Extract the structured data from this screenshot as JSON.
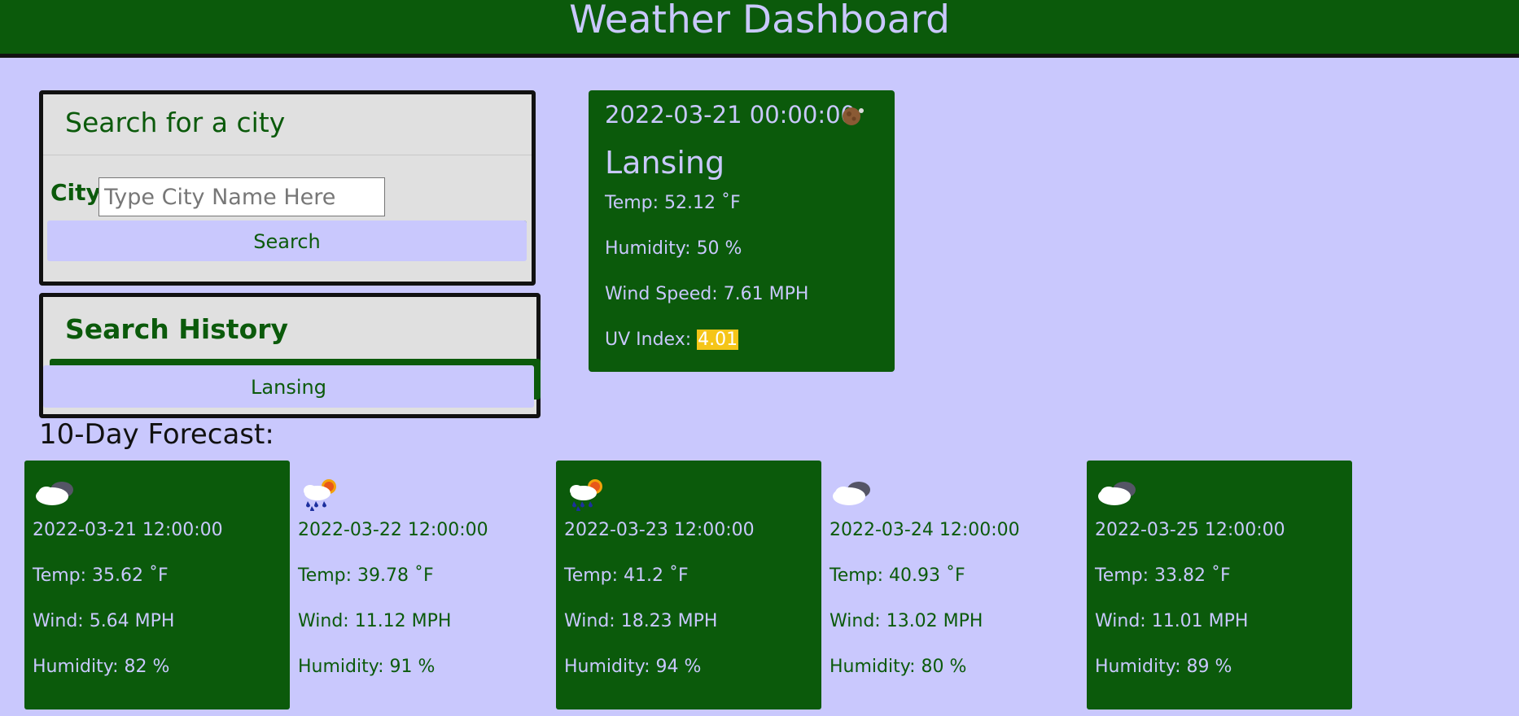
{
  "header": {
    "title": "Weather Dashboard"
  },
  "search": {
    "title": "Search for a city",
    "city_label": "City",
    "placeholder": "Type City Name Here",
    "value": "",
    "button_label": "Search"
  },
  "history": {
    "title": "Search History",
    "items": [
      {
        "label": "Lansing"
      }
    ]
  },
  "current": {
    "date": "2022-03-21 00:00:00",
    "icon": "night-partly-cloudy-icon",
    "city": "Lansing",
    "temp_label": "Temp: ",
    "temp": "52.12 ˚F",
    "humidity_label": "Humidity: ",
    "humidity": "50 %",
    "wind_label": "Wind Speed: ",
    "wind": "7.61 MPH",
    "uv_label": "UV Index: ",
    "uv": "4.01",
    "uv_color": "#f5c518"
  },
  "forecast": {
    "title": "10-Day Forecast:",
    "days": [
      {
        "icon": "cloudy-icon",
        "date": "2022-03-21 12:00:00",
        "temp": "Temp: 35.62 ˚F",
        "wind": "Wind: 5.64 MPH",
        "humidity": "Humidity: 82 %"
      },
      {
        "icon": "rain-sun-icon",
        "date": "2022-03-22 12:00:00",
        "temp": "Temp: 39.78 ˚F",
        "wind": "Wind: 11.12 MPH",
        "humidity": "Humidity: 91 %"
      },
      {
        "icon": "rain-sun-icon",
        "date": "2022-03-23 12:00:00",
        "temp": "Temp: 41.2 ˚F",
        "wind": "Wind: 18.23 MPH",
        "humidity": "Humidity: 94 %"
      },
      {
        "icon": "cloudy-icon",
        "date": "2022-03-24 12:00:00",
        "temp": "Temp: 40.93 ˚F",
        "wind": "Wind: 13.02 MPH",
        "humidity": "Humidity: 80 %"
      },
      {
        "icon": "cloudy-icon",
        "date": "2022-03-25 12:00:00",
        "temp": "Temp: 33.82 ˚F",
        "wind": "Wind: 11.01 MPH",
        "humidity": "Humidity: 89 %"
      }
    ]
  },
  "colors": {
    "primary": "#0b5a0b",
    "accent": "#c9c8fd",
    "panel": "#e0e0e0"
  }
}
